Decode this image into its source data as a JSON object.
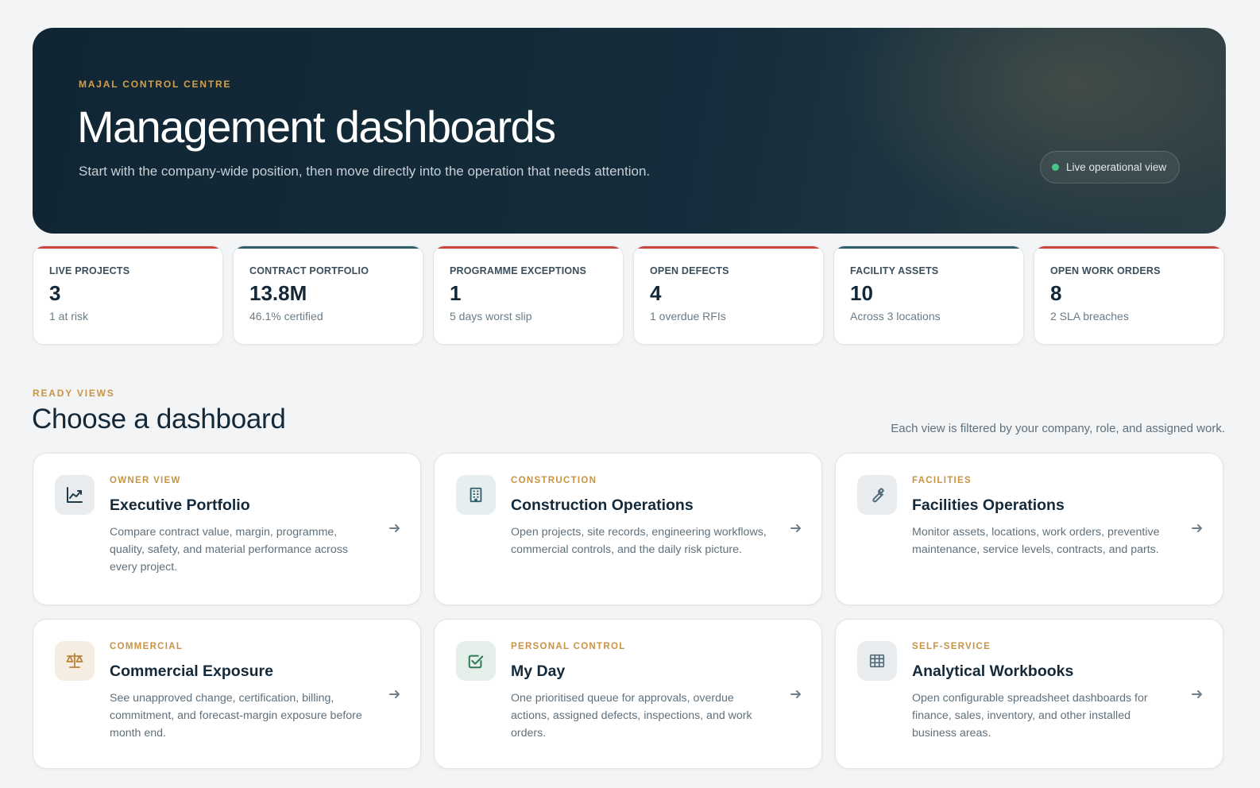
{
  "hero": {
    "eyebrow": "MAJAL CONTROL CENTRE",
    "title": "Management dashboards",
    "subtitle": "Start with the company-wide position, then move directly into the operation that needs attention.",
    "live_label": "Live operational view"
  },
  "kpis": [
    {
      "label": "LIVE PROJECTS",
      "value": "3",
      "note": "1 at risk",
      "accent": "#c9463d"
    },
    {
      "label": "CONTRACT PORTFOLIO",
      "value": "13.8M",
      "note": "46.1% certified",
      "accent": "#2f5f6b"
    },
    {
      "label": "PROGRAMME EXCEPTIONS",
      "value": "1",
      "note": "5 days worst slip",
      "accent": "#c9463d"
    },
    {
      "label": "OPEN DEFECTS",
      "value": "4",
      "note": "1 overdue RFIs",
      "accent": "#c9463d"
    },
    {
      "label": "FACILITY ASSETS",
      "value": "10",
      "note": "Across 3 locations",
      "accent": "#2f5f6b"
    },
    {
      "label": "OPEN WORK ORDERS",
      "value": "8",
      "note": "2 SLA breaches",
      "accent": "#c9463d"
    }
  ],
  "section": {
    "eyebrow": "READY VIEWS",
    "title": "Choose a dashboard",
    "note": "Each view is filtered by your company, role, and assigned work."
  },
  "dashboards": [
    {
      "eyebrow": "OWNER VIEW",
      "title": "Executive Portfolio",
      "description": "Compare contract value, margin, programme, quality, safety, and material performance across every project.",
      "icon": "trend-chart-icon"
    },
    {
      "eyebrow": "CONSTRUCTION",
      "title": "Construction Operations",
      "description": "Open projects, site records, engineering workflows, commercial controls, and the daily risk picture.",
      "icon": "building-icon"
    },
    {
      "eyebrow": "FACILITIES",
      "title": "Facilities Operations",
      "description": "Monitor assets, locations, work orders, preventive maintenance, service levels, contracts, and parts.",
      "icon": "wrench-icon"
    },
    {
      "eyebrow": "COMMERCIAL",
      "title": "Commercial Exposure",
      "description": "See unapproved change, certification, billing, commitment, and forecast-margin exposure before month end.",
      "icon": "scale-icon"
    },
    {
      "eyebrow": "PERSONAL CONTROL",
      "title": "My Day",
      "description": "One prioritised queue for approvals, overdue actions, assigned defects, inspections, and work orders.",
      "icon": "checkbox-icon"
    },
    {
      "eyebrow": "SELF-SERVICE",
      "title": "Analytical Workbooks",
      "description": "Open configurable spreadsheet dashboards for finance, sales, inventory, and other installed business areas.",
      "icon": "table-icon"
    }
  ]
}
